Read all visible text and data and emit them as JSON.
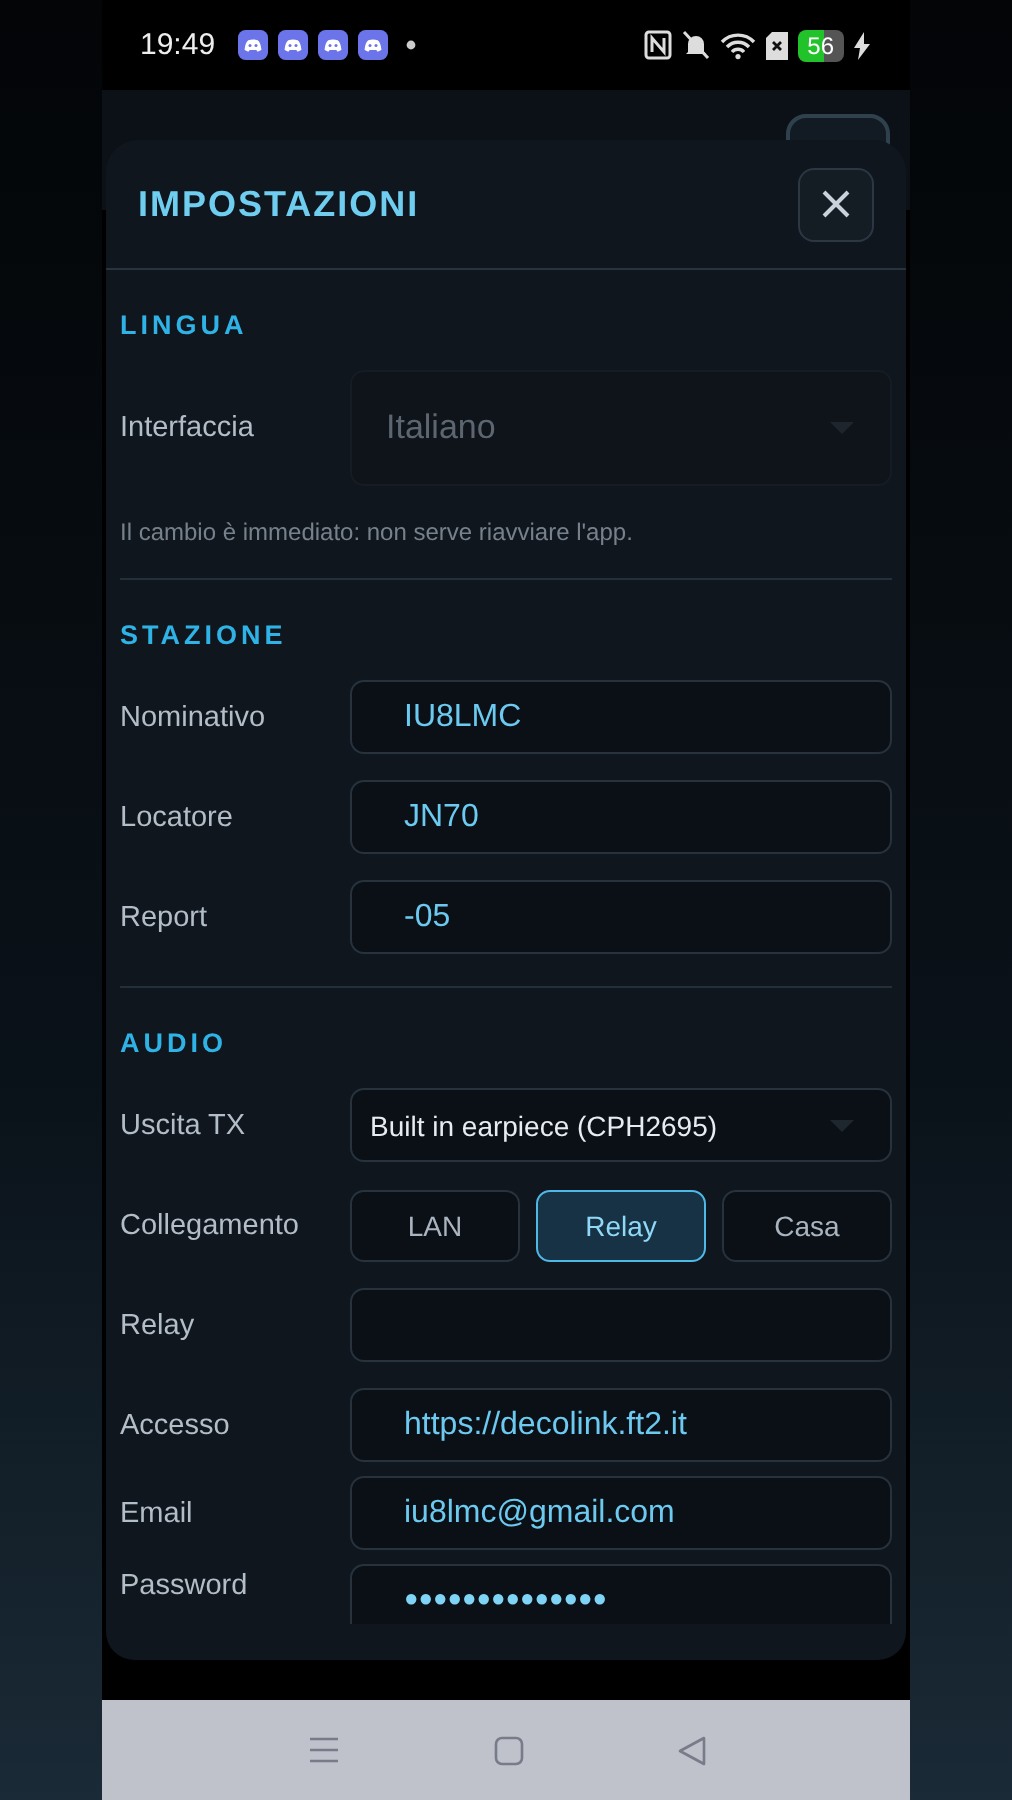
{
  "status_bar": {
    "time": "19:49",
    "battery": "56"
  },
  "dialog": {
    "title": "IMPOSTAZIONI",
    "sections": [
      {
        "title": "LINGUA",
        "hint": "Il cambio è immediato: non serve riavviare l'app.",
        "rows": [
          {
            "kind": "select",
            "label": "Interfaccia",
            "value": "Italiano",
            "disabled": true
          }
        ]
      },
      {
        "title": "STAZIONE",
        "rows": [
          {
            "kind": "input",
            "label": "Nominativo",
            "value": "IU8LMC"
          },
          {
            "kind": "input",
            "label": "Locatore",
            "value": "JN70"
          },
          {
            "kind": "input",
            "label": "Report",
            "value": "-05"
          }
        ]
      },
      {
        "title": "AUDIO",
        "rows": [
          {
            "kind": "select",
            "label": "Uscita TX",
            "value": "Built in earpiece (CPH2695)",
            "disabled": false
          },
          {
            "kind": "segmented",
            "label": "Collegamento",
            "options": [
              {
                "label": "LAN",
                "selected": false
              },
              {
                "label": "Relay",
                "selected": true
              },
              {
                "label": "Casa",
                "selected": false
              }
            ]
          },
          {
            "kind": "input",
            "label": "Relay"
          },
          {
            "kind": "input",
            "label": "Accesso",
            "value": "https://decolink.ft2.it"
          },
          {
            "kind": "input",
            "label": "Email",
            "value": "iu8lmc@gmail.com"
          },
          {
            "kind": "password",
            "label": "Password",
            "value": "●●●●●●●●●●●●●●"
          }
        ]
      }
    ]
  }
}
